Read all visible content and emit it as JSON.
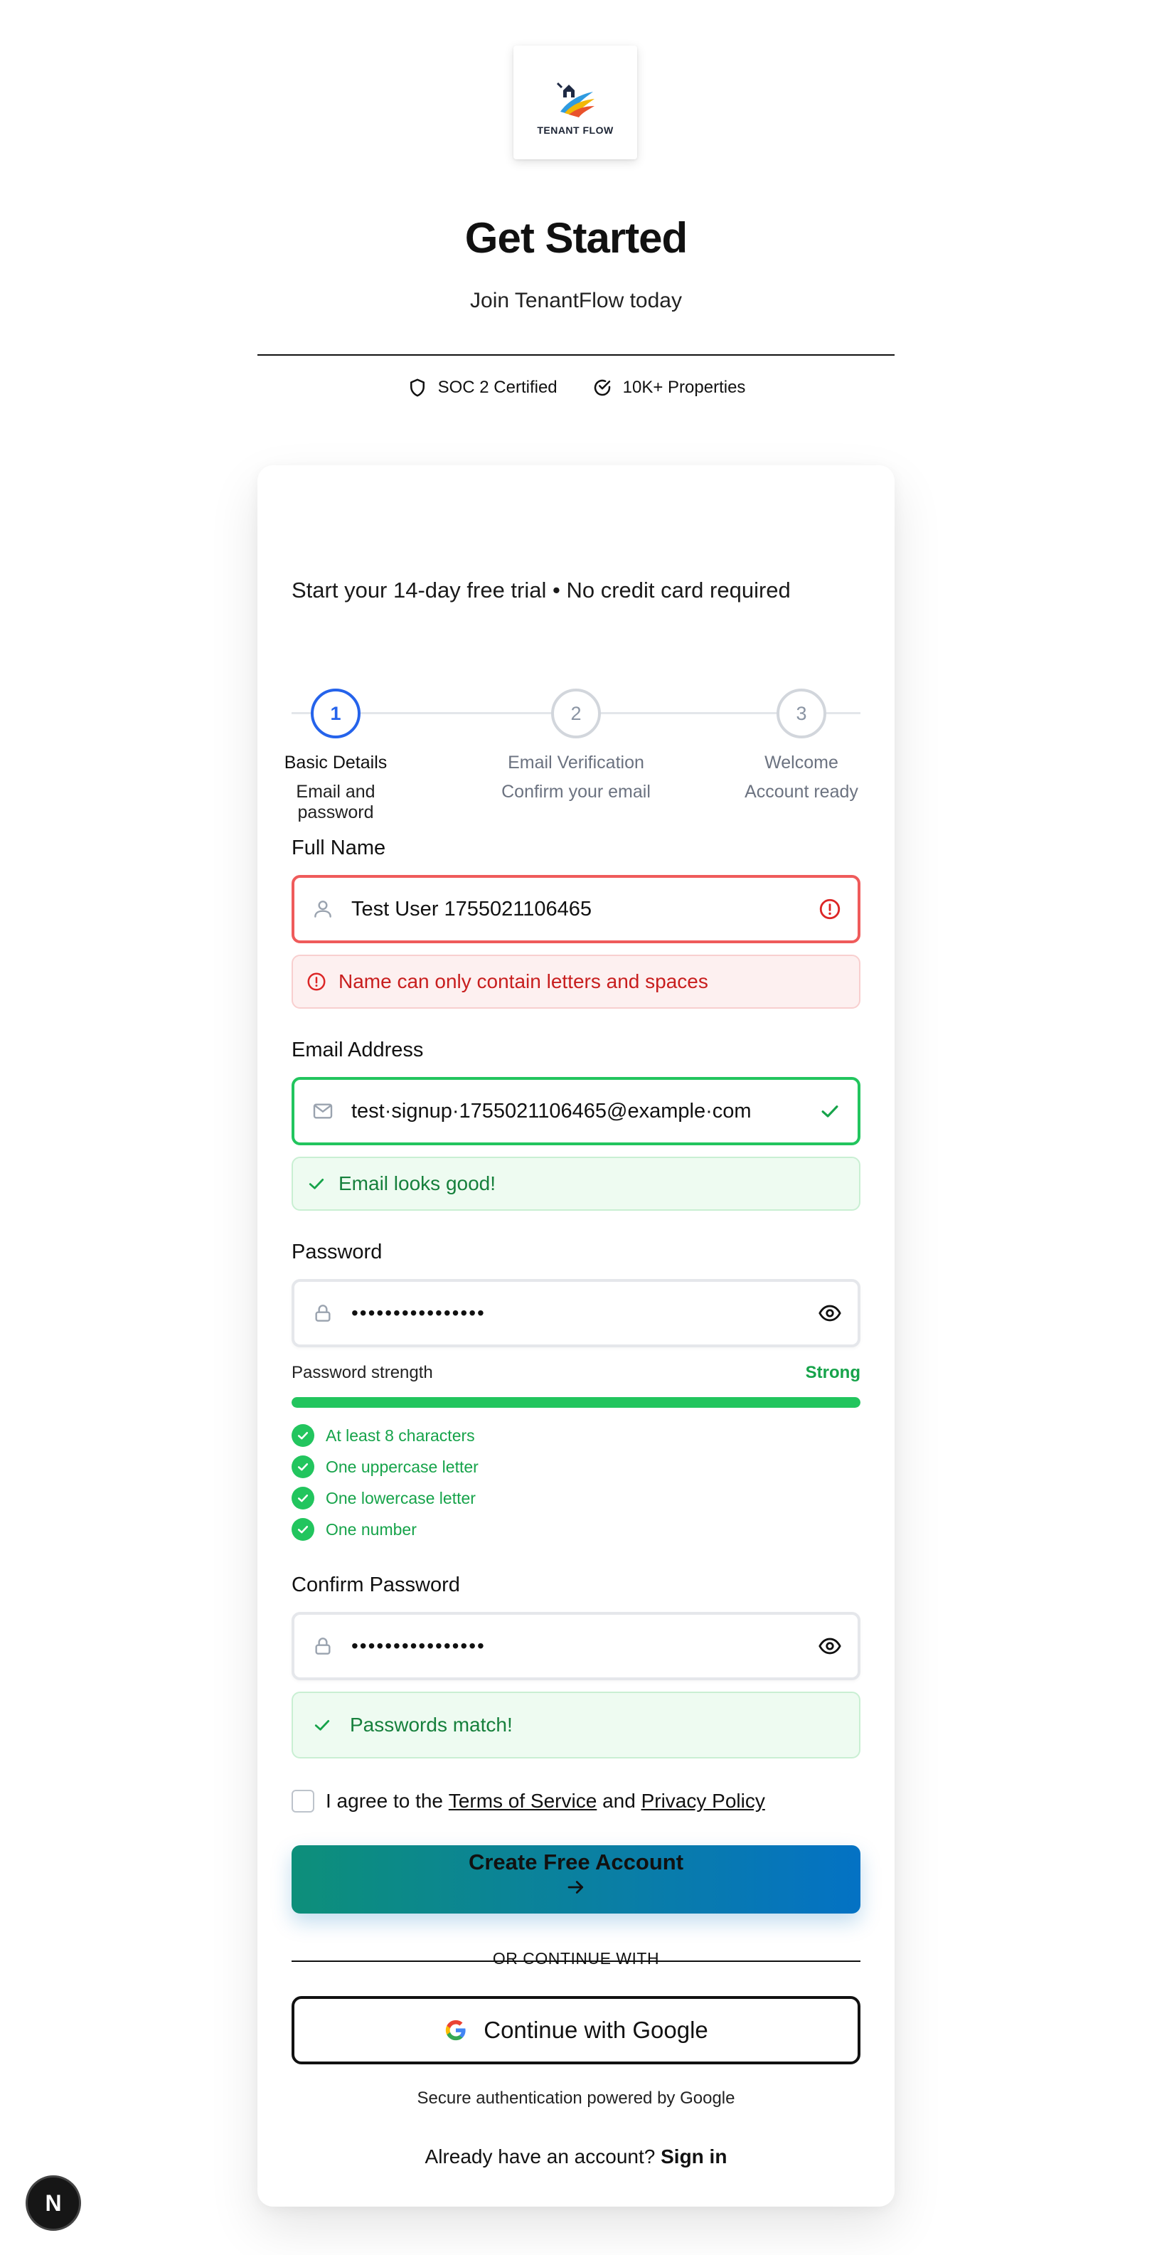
{
  "brand": {
    "logo_text": "TENANT FLOW"
  },
  "header": {
    "title": "Get Started",
    "subtitle": "Join TenantFlow today"
  },
  "badges": [
    {
      "icon": "shield-icon",
      "label": "SOC 2 Certified"
    },
    {
      "icon": "check-circle-icon",
      "label": "10K+ Properties"
    }
  ],
  "card": {
    "trial_text": "Start your 14-day free trial • No credit card required"
  },
  "steps": [
    {
      "number": "1",
      "title": "Basic Details",
      "subtitle": "Email and password",
      "state": "active"
    },
    {
      "number": "2",
      "title": "Email Verification",
      "subtitle": "Confirm your email",
      "state": "pending"
    },
    {
      "number": "3",
      "title": "Welcome",
      "subtitle": "Account ready",
      "state": "pending"
    }
  ],
  "form": {
    "full_name": {
      "label": "Full Name",
      "value": "Test User 1755021106465",
      "error": "Name can only contain letters and spaces"
    },
    "email": {
      "label": "Email Address",
      "value": "test·signup·1755021106465@example·com",
      "success": "Email looks good!"
    },
    "password": {
      "label": "Password",
      "value_masked": "••••••••••••••••",
      "strength_label": "Password strength",
      "strength_value": "Strong",
      "strength_fraction": 1.0,
      "requirements": [
        "At least 8 characters",
        "One uppercase letter",
        "One lowercase letter",
        "One number"
      ]
    },
    "confirm_password": {
      "label": "Confirm Password",
      "value_masked": "••••••••••••••••",
      "success": "Passwords match!"
    },
    "agree": {
      "prefix": "I agree to the",
      "terms": "Terms of Service",
      "and": "and",
      "privacy": "Privacy Policy"
    },
    "submit_label": "Create Free Account",
    "divider_text": "OR CONTINUE WITH",
    "google_label": "Continue with Google",
    "secure_text": "Secure authentication powered by Google",
    "signin_prompt": "Already have an account?",
    "signin_link": "Sign in"
  },
  "dev_badge": {
    "letter": "N"
  },
  "colors": {
    "primary_blue": "#2563eb",
    "error": "#ef5b5b",
    "success": "#22c55e",
    "gradient_start": "#0d8f7a",
    "gradient_end": "#0472c4"
  }
}
